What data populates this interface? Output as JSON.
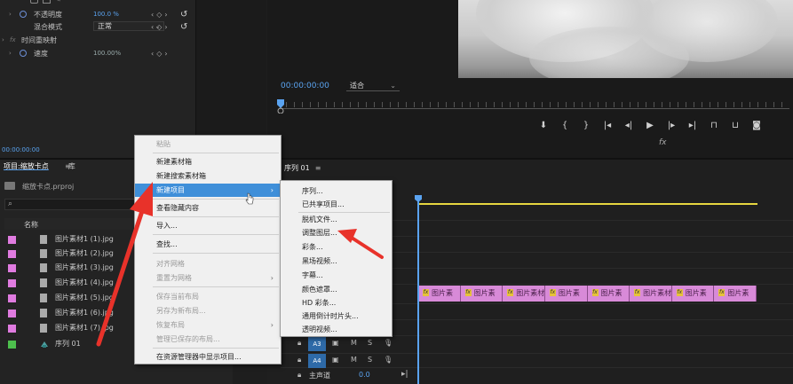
{
  "effect_controls": {
    "opacity_label": "不透明度",
    "opacity_value": "100.0 %",
    "blend_label": "混合模式",
    "blend_value": "正常",
    "time_remap_label": "时间重映射",
    "speed_label": "速度",
    "speed_value": "100.00%",
    "timecode": "00:00:00:00"
  },
  "monitor": {
    "timecode": "00:00:00:00",
    "fit": "适合",
    "fx_glyph": "fx"
  },
  "project": {
    "tabs": [
      "项目:缩放卡点",
      "库"
    ],
    "path": "缩放卡点.prproj",
    "column_name": "名称",
    "items": [
      {
        "name": "图片素材1 (1).jpg",
        "color": "#e07be0"
      },
      {
        "name": "图片素材1 (2).jpg",
        "color": "#e07be0"
      },
      {
        "name": "图片素材1 (3).jpg",
        "color": "#e07be0"
      },
      {
        "name": "图片素材1 (4).jpg",
        "color": "#e07be0"
      },
      {
        "name": "图片素材1 (5).jpg",
        "color": "#e07be0"
      },
      {
        "name": "图片素材1 (6).jpg",
        "color": "#e07be0"
      },
      {
        "name": "图片素材1 (7).jpg",
        "color": "#e07be0"
      },
      {
        "name": "序列 01",
        "color": "#4dbf4d"
      }
    ]
  },
  "timeline": {
    "title": "序列 01",
    "clips": [
      "图片素",
      "图片素",
      "图片素材",
      "图片素",
      "图片素",
      "图片素材",
      "图片素",
      "图片素"
    ],
    "tracks": [
      {
        "name": "A3"
      },
      {
        "name": "A4"
      }
    ],
    "master_label": "主声道",
    "master_value": "0.0"
  },
  "context_menu": {
    "items": [
      {
        "label": "粘贴",
        "disabled": true
      },
      {
        "label": "新建素材箱"
      },
      {
        "label": "新建搜索素材箱"
      },
      {
        "label": "新建项目",
        "highlighted": true,
        "submenu": true
      },
      {
        "label": "查看隐藏内容"
      },
      {
        "label": "导入..."
      },
      {
        "label": "查找..."
      },
      {
        "label": "对齐网格",
        "disabled": true
      },
      {
        "label": "重置为网格",
        "disabled": true,
        "submenu": true
      },
      {
        "label": "保存当前布局",
        "disabled": true
      },
      {
        "label": "另存为新布局...",
        "disabled": true
      },
      {
        "label": "恢复布局",
        "disabled": true,
        "submenu": true
      },
      {
        "label": "管理已保存的布局...",
        "disabled": true
      },
      {
        "label": "在资源管理器中显示项目..."
      }
    ]
  },
  "submenu": {
    "items": [
      "序列...",
      "已共享项目...",
      "脱机文件...",
      "调整图层...",
      "彩条...",
      "黑场视频...",
      "字幕...",
      "颜色遮罩...",
      "HD 彩条...",
      "通用倒计时片头...",
      "透明视频..."
    ]
  },
  "colors": {
    "accent_blue": "#5aa3f0",
    "clip_pink": "#d88ad8",
    "arrow_red": "#e8322a",
    "highlight": "#3f8fd9"
  }
}
